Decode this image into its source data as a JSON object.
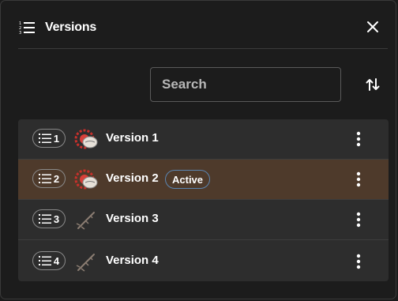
{
  "header": {
    "title": "Versions",
    "title_icon": "numbered-list-icon",
    "close_icon": "close-icon"
  },
  "search": {
    "placeholder": "Search",
    "value": ""
  },
  "sort_icon": "sort-arrows-icon",
  "versions": [
    {
      "number": "1",
      "name": "Version 1",
      "thumbnail": "red-coiled-creature",
      "active": false,
      "menu_icon": "kebab-menu-icon"
    },
    {
      "number": "2",
      "name": "Version 2",
      "thumbnail": "red-coiled-creature",
      "active": true,
      "active_label": "Active",
      "menu_icon": "kebab-menu-icon"
    },
    {
      "number": "3",
      "name": "Version 3",
      "thumbnail": "sketch-rifle",
      "active": false,
      "menu_icon": "kebab-menu-icon"
    },
    {
      "number": "4",
      "name": "Version 4",
      "thumbnail": "sketch-rifle",
      "active": false,
      "menu_icon": "kebab-menu-icon"
    }
  ],
  "colors": {
    "background": "#1c1c1c",
    "list_background": "#2d2d2d",
    "active_row": "#4e3a2b",
    "active_pill_border": "#5b86b3"
  }
}
